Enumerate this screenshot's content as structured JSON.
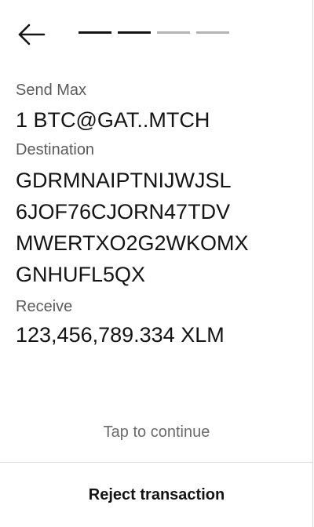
{
  "header": {
    "back_icon": "arrow-left-icon",
    "progress": {
      "total_steps": 4,
      "completed_steps": 2
    }
  },
  "send": {
    "label": "Send Max",
    "value": "1 BTC@GAT..MTCH"
  },
  "destination": {
    "label": "Destination",
    "lines": [
      "GDRMNAIPTNIJWJSL",
      "6JOF76CJORN47TDV",
      "MWERTXO2G2WKOMX",
      "GNHUFL5QX"
    ]
  },
  "receive": {
    "label": "Receive",
    "value": "123,456,789.334 XLM"
  },
  "footer": {
    "tap_hint": "Tap to continue",
    "reject_label": "Reject transaction"
  },
  "colors": {
    "text": "#141414",
    "muted": "#5b5b5b",
    "progress_done": "#141414",
    "progress_todo": "#b3b3b3",
    "divider": "#d9d9d9"
  }
}
